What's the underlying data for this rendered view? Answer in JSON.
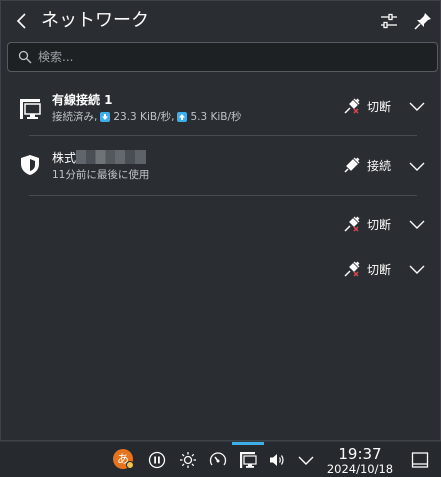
{
  "header": {
    "title": "ネットワーク"
  },
  "search": {
    "placeholder": "検索..."
  },
  "connections": [
    {
      "name": "有線接続 1",
      "status": "接続済み,",
      "down_speed": "23.3 KiB/秒,",
      "up_speed": "5.3 KiB/秒",
      "action": "切断"
    },
    {
      "name": "株式",
      "status": "11分前に最後に使用",
      "action": "接続"
    },
    {
      "name": "",
      "status": "",
      "action": "切断"
    },
    {
      "name": "",
      "status": "",
      "action": "切断"
    }
  ],
  "panel": {
    "ime_label": "あ",
    "time": "19:37",
    "date": "2024/10/18"
  },
  "colors": {
    "accent": "#3daee9",
    "bg": "#2a2e32",
    "disconnect_x": "#da4453"
  }
}
